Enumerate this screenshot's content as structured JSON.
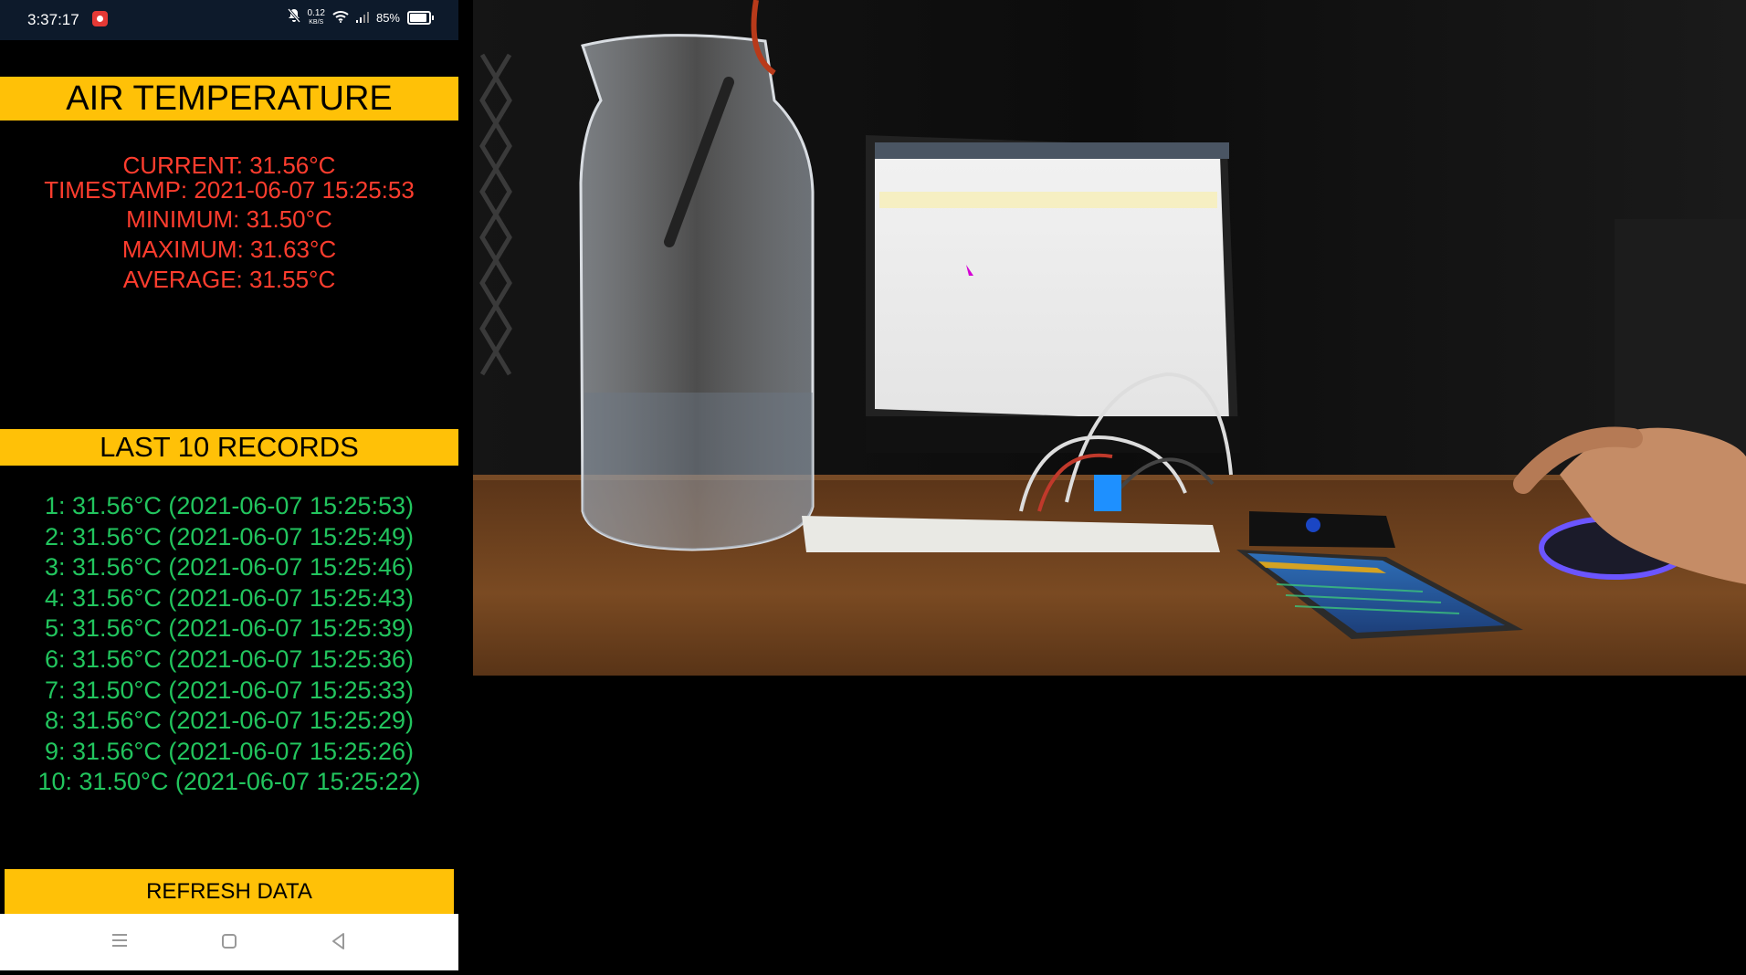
{
  "status_bar": {
    "time": "3:37:17",
    "net_speed_value": "0.12",
    "net_speed_unit": "KB/S",
    "battery": "85%"
  },
  "app": {
    "title": "AIR TEMPERATURE",
    "stats": {
      "current": "CURRENT: 31.56°C",
      "timestamp": "TIMESTAMP: 2021-06-07 15:25:53",
      "minimum": "MINIMUM: 31.50°C",
      "maximum": "MAXIMUM: 31.63°C",
      "average": "AVERAGE: 31.55°C"
    },
    "records_title": "LAST 10 RECORDS",
    "records": [
      "1: 31.56°C (2021-06-07 15:25:53)",
      "2: 31.56°C (2021-06-07 15:25:49)",
      "3: 31.56°C (2021-06-07 15:25:46)",
      "4: 31.56°C (2021-06-07 15:25:43)",
      "5: 31.56°C (2021-06-07 15:25:39)",
      "6: 31.56°C (2021-06-07 15:25:36)",
      "7: 31.50°C (2021-06-07 15:25:33)",
      "8: 31.56°C (2021-06-07 15:25:29)",
      "9: 31.56°C (2021-06-07 15:25:26)",
      "10: 31.50°C (2021-06-07 15:25:22)"
    ],
    "refresh_label": "REFRESH DATA"
  },
  "nav": {
    "menu_icon": "menu-icon",
    "home_icon": "home-icon",
    "back_icon": "back-icon"
  },
  "colors": {
    "accent": "#ffc107",
    "stats_text": "#ff3d2e",
    "records_text": "#22c55e"
  }
}
